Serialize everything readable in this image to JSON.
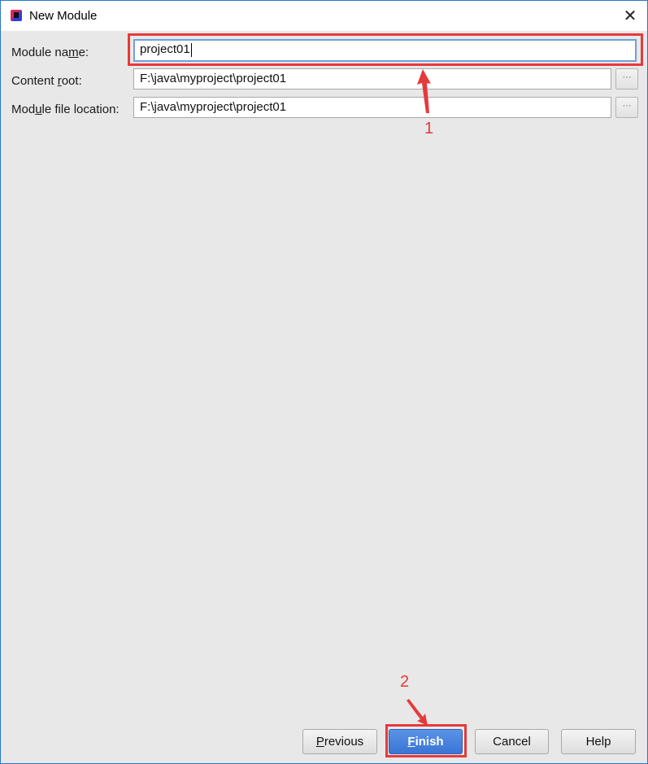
{
  "window": {
    "title": "New Module",
    "close_label": "✕"
  },
  "form": {
    "module_name": {
      "label_pre": "Module na",
      "label_mn": "m",
      "label_post": "e:",
      "value": "project01"
    },
    "content_root": {
      "label_pre": "Content ",
      "label_mn": "r",
      "label_post": "oot:",
      "value": "F:\\java\\myproject\\project01",
      "browse_label": "···"
    },
    "module_file_location": {
      "label_pre": "Mod",
      "label_mn": "u",
      "label_post": "le file location:",
      "value": "F:\\java\\myproject\\project01",
      "browse_label": "···"
    }
  },
  "buttons": {
    "previous_mn": "P",
    "previous_rest": "revious",
    "finish_mn": "F",
    "finish_rest": "inish",
    "cancel": "Cancel",
    "help": "Help"
  },
  "annotations": {
    "step1": "1",
    "step2": "2",
    "color": "#e63a3a"
  }
}
